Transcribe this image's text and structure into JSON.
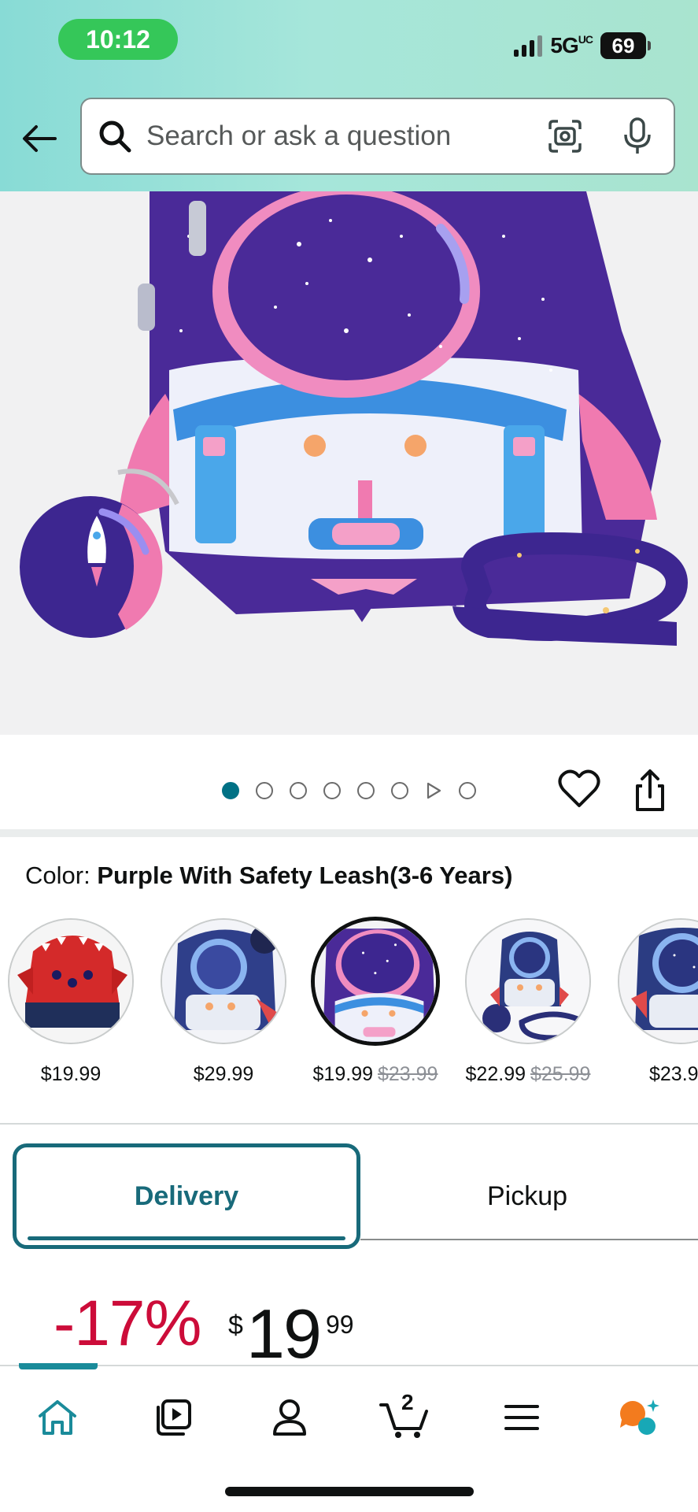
{
  "status_bar": {
    "time": "10:12",
    "network": "5G",
    "network_sup": "UC",
    "battery": "69"
  },
  "header": {
    "search_placeholder": "Search or ask a question",
    "back_icon": "arrow-left-icon",
    "camera_icon": "camera-lens-icon",
    "mic_icon": "microphone-icon"
  },
  "gallery": {
    "image_count": 8,
    "active_index": 0,
    "video_index": 6
  },
  "color": {
    "label": "Color:",
    "value": "Purple With Safety Leash(3-6 Years)"
  },
  "swatches": [
    {
      "price": "$19.99",
      "was": "",
      "style": "red-dinosaur"
    },
    {
      "price": "$29.99",
      "was": "",
      "style": "blue-astronaut-set"
    },
    {
      "price": "$19.99",
      "was": "$23.99",
      "style": "purple-rocket",
      "selected": true
    },
    {
      "price": "$22.99",
      "was": "$25.99",
      "style": "navy-astronaut-leash"
    },
    {
      "price": "$23.9",
      "was": "",
      "style": "navy-astronaut"
    }
  ],
  "fulfillment": {
    "delivery": "Delivery",
    "pickup": "Pickup"
  },
  "price": {
    "discount": "-17%",
    "currency": "$",
    "whole": "19",
    "fraction": "99"
  },
  "bottom_nav": {
    "cart_count": "2",
    "items": [
      "home-icon",
      "video-icon",
      "account-icon",
      "cart-icon",
      "menu-icon",
      "rufus-chat-icon"
    ]
  },
  "colors": {
    "accent_teal": "#186a7a",
    "active_dot": "#007185",
    "deal_red": "#cc0c39",
    "header_gradient_start": "#88dbd6",
    "header_gradient_end": "#a9e4cf"
  }
}
